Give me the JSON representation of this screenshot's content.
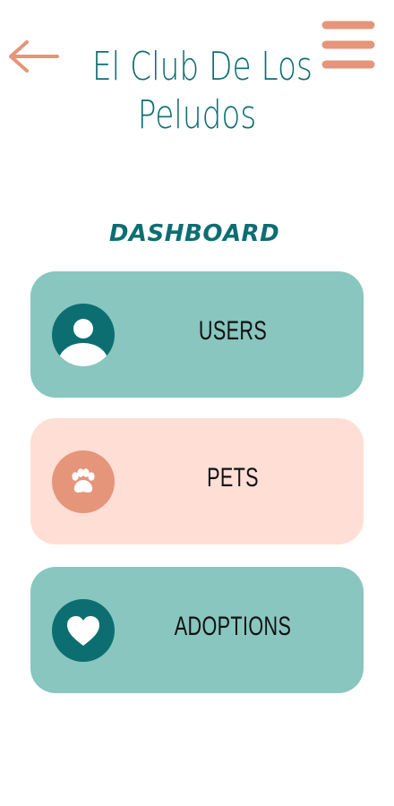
{
  "header": {
    "back_icon": "arrow-left-icon",
    "menu_icon": "hamburger-menu-icon",
    "title_line1": "El Club De Los",
    "title_line2": "Peludos"
  },
  "dashboard": {
    "title": "DASHBOARD",
    "cards": [
      {
        "label": "USERS",
        "icon": "user-icon",
        "color": "#88c6bf",
        "icon_bg": "#0d6e72"
      },
      {
        "label": "PETS",
        "icon": "paw-icon",
        "color": "#ffded6",
        "icon_bg": "#e5957a"
      },
      {
        "label": "ADOPTIONS",
        "icon": "heart-icon",
        "color": "#88c6bf",
        "icon_bg": "#0d6e72"
      }
    ]
  },
  "colors": {
    "accent": "#0d6e72",
    "secondary": "#e5957a",
    "teal_card": "#88c6bf",
    "pink_card": "#ffded6"
  }
}
